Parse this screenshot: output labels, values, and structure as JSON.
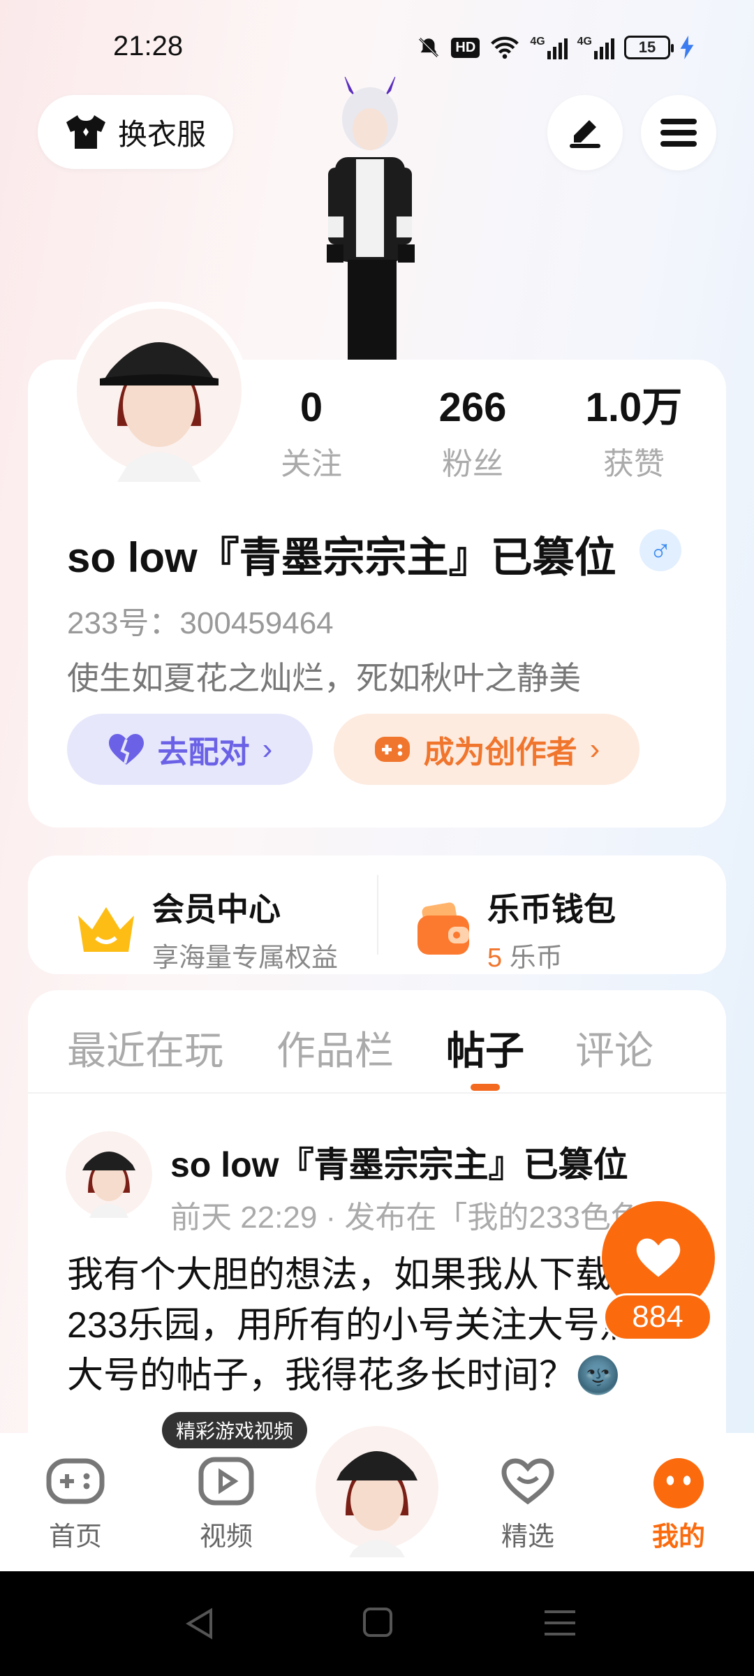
{
  "status_bar": {
    "time": "21:28",
    "battery": "15",
    "net1": "4G",
    "net2": "4G",
    "hd": "HD"
  },
  "top": {
    "dress_label": "换衣服"
  },
  "stats": [
    {
      "value": "0",
      "label": "关注"
    },
    {
      "value": "266",
      "label": "粉丝"
    },
    {
      "value": "1.0万",
      "label": "获赞"
    }
  ],
  "profile": {
    "name": "so low『青墨宗宗主』已篡位",
    "gender_symbol": "♂",
    "uid": "233号：300459464",
    "bio": "使生如夏花之灿烂，死如秋叶之静美"
  },
  "actions": {
    "match_label": "去配对",
    "creator_label": "成为创作者"
  },
  "member": {
    "title": "会员中心",
    "subtitle": "享海量专属权益"
  },
  "wallet": {
    "title": "乐币钱包",
    "amount": "5",
    "unit": "乐币"
  },
  "tabs": [
    "最近在玩",
    "作品栏",
    "帖子",
    "评论"
  ],
  "post": {
    "author": "so low『青墨宗宗主』已篡位",
    "meta": "前天 22:29 · 发布在「我的233色色",
    "body": "我有个大胆的想法，如果我从下载遍233乐园，用所有的小号关注大号点赞大号的帖子，我得花多长时间？🌚",
    "likes": "884"
  },
  "nav": {
    "tooltip": "精彩游戏视频",
    "items": [
      "首页",
      "视频",
      "精选",
      "我的"
    ]
  },
  "colors": {
    "accent": "#fb6a0d",
    "purple": "#6a61e6"
  }
}
